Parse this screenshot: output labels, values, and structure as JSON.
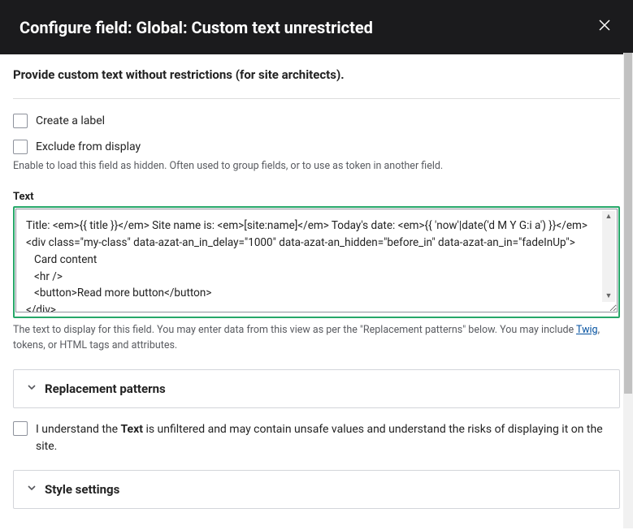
{
  "header": {
    "title": "Configure field: Global: Custom text unrestricted"
  },
  "subtitle": "Provide custom text without restrictions (for site architects).",
  "create_label": {
    "label": "Create a label"
  },
  "exclude": {
    "label": "Exclude from display",
    "help": "Enable to load this field as hidden. Often used to group fields, or to use as token in another field."
  },
  "text_field": {
    "label": "Text",
    "value": "Title: <em>{{ title }}</em> Site name is: <em>[site:name]</em> Today's date: <em>{{ 'now'|date('d M Y G:i a') }}</em>\n<div class=\"my-class\" data-azat-an_in_delay=\"1000\" data-azat-an_hidden=\"before_in\" data-azat-an_in=\"fadeInUp\">\n   Card content\n   <hr />\n   <button>Read more button</button>\n</div>",
    "desc_pre": "The text to display for this field. You may enter data from this view as per the \"Replacement patterns\" below. You may include ",
    "desc_link": "Twig",
    "desc_post": ", tokens, or HTML tags and attributes."
  },
  "replacement_patterns": {
    "label": "Replacement patterns"
  },
  "ack": {
    "pre": "I understand the ",
    "bold": "Text",
    "post": " is unfiltered and may contain unsafe values and understand the risks of displaying it on the site."
  },
  "style_settings": {
    "label": "Style settings"
  }
}
